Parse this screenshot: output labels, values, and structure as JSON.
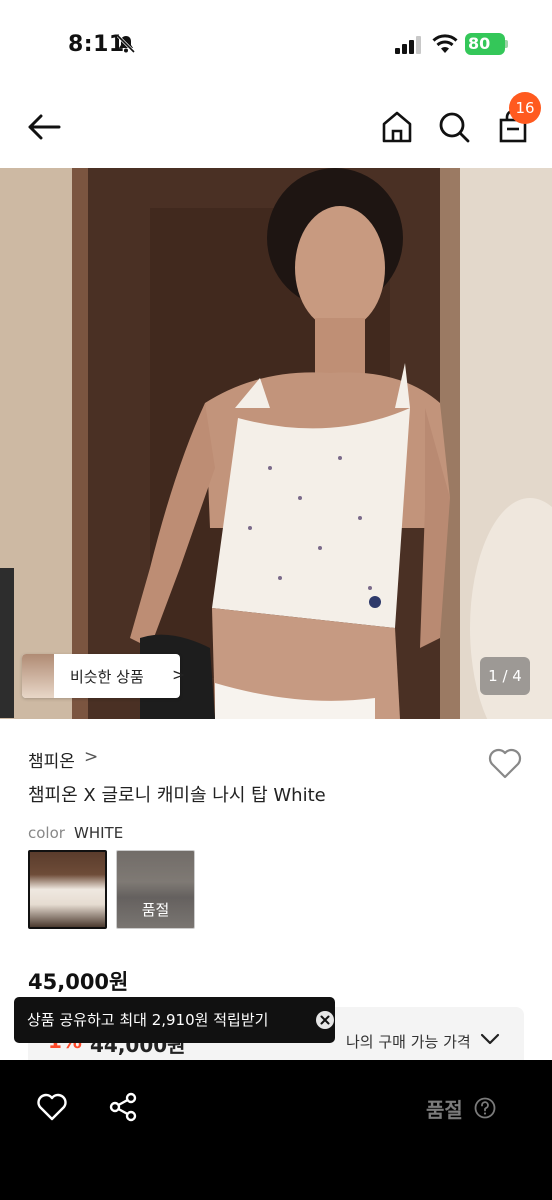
{
  "status": {
    "time": "8:11",
    "battery": "80"
  },
  "header": {
    "cart_count": "16"
  },
  "gallery": {
    "similar_label": "비슷한 상품",
    "similar_chevron": ">",
    "counter": "1 / 4"
  },
  "product": {
    "brand": "챔피온",
    "brand_chevron": ">",
    "title": "챔피온 X 글로니 캐미솔 나시 탑 White",
    "color_label": "color",
    "color_value": "WHITE",
    "color_options": [
      {
        "name": "white",
        "state": "selected"
      },
      {
        "name": "second",
        "state": "품절"
      }
    ],
    "price": "45,000원",
    "discount_pct": "1%",
    "discount_price": "44,000원",
    "my_price_label": "나의 구매 가능 가격"
  },
  "toast": {
    "text": "상품 공유하고 최대 2,910원 적립받기"
  },
  "bottom": {
    "soldout_label": "품절"
  },
  "colors": {
    "badge": "#ff5a1f",
    "discount": "#ff4b2b",
    "battery": "#34c759"
  }
}
